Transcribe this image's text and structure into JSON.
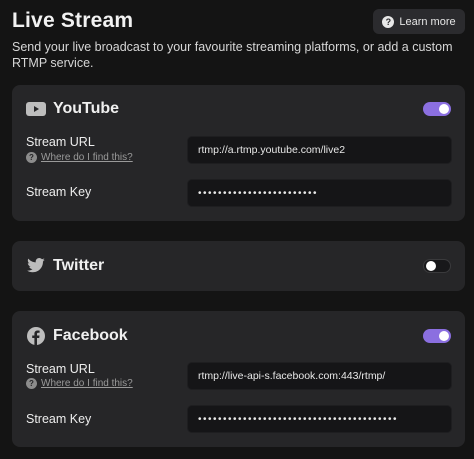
{
  "header": {
    "title": "Live Stream",
    "learn_more": "Learn more",
    "subtitle": "Send your live broadcast to your favourite streaming platforms, or add a custom RTMP service."
  },
  "services": {
    "youtube": {
      "name": "YouTube",
      "enabled": true,
      "url_label": "Stream URL",
      "help_text": "Where do I find this?",
      "url_value": "rtmp://a.rtmp.youtube.com/live2",
      "key_label": "Stream Key",
      "key_value": "••••••••••••••••••••••••"
    },
    "twitter": {
      "name": "Twitter",
      "enabled": false
    },
    "facebook": {
      "name": "Facebook",
      "enabled": true,
      "url_label": "Stream URL",
      "help_text": "Where do I find this?",
      "url_value": "rtmp://live-api-s.facebook.com:443/rtmp/",
      "key_label": "Stream Key",
      "key_value": "••••••••••••••••••••••••••••••••••••••••"
    }
  },
  "colors": {
    "background": "#141414",
    "card": "#262628",
    "toggle_on": "#8b6fe0",
    "input": "#151517"
  }
}
